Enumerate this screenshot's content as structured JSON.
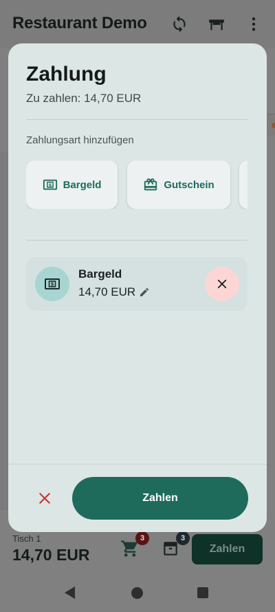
{
  "app": {
    "title": "Restaurant Demo",
    "icons": [
      "sync-icon",
      "table-icon",
      "more-vertical-icon"
    ]
  },
  "dialog": {
    "title": "Zahlung",
    "amount_due_label": "Zu zahlen: 14,70 EUR",
    "section_label": "Zahlungsart hinzufügen",
    "methods": [
      {
        "label": "Bargeld",
        "icon": "cash-icon"
      },
      {
        "label": "Gutschein",
        "icon": "gift-card-icon"
      }
    ],
    "payment": {
      "method": "Bargeld",
      "amount": "14,70 EUR",
      "icon": "cash-icon"
    },
    "pay_label": "Zahlen"
  },
  "bottom": {
    "table_label": "Tisch 1",
    "total": "14,70 EUR",
    "cart_badge": "3",
    "order_badge": "3",
    "pay_label": "Zahlen"
  },
  "colors": {
    "primary": "#1e6b5c",
    "danger": "#d32f2f",
    "dialog_bg": "#dce6e5"
  }
}
